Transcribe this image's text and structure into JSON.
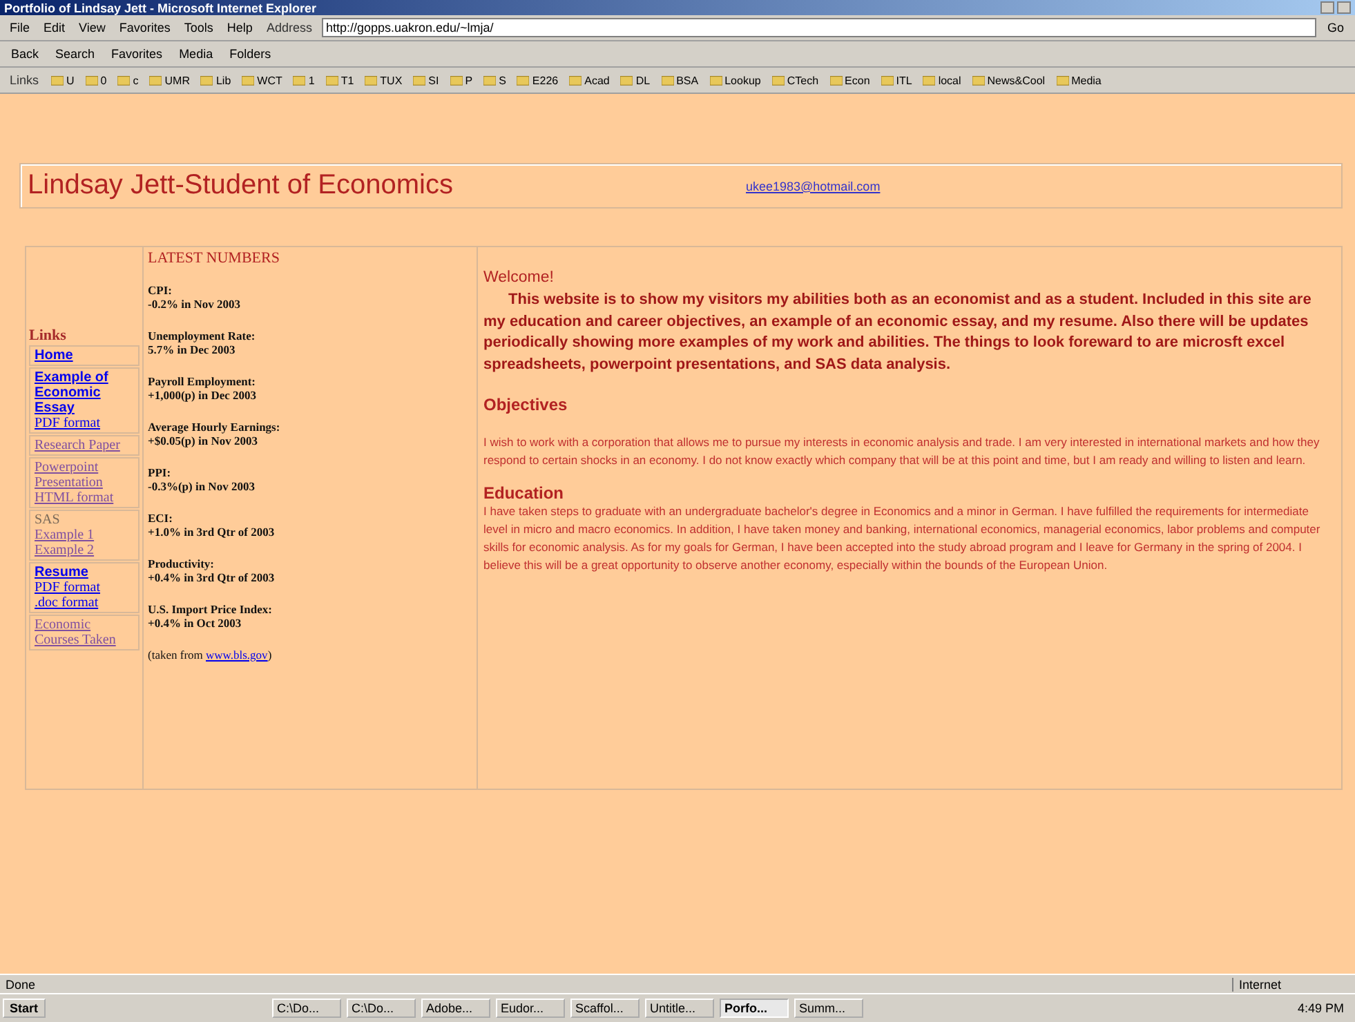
{
  "window": {
    "title": "Portfolio of Lindsay Jett - Microsoft Internet Explorer"
  },
  "menu": [
    "File",
    "Edit",
    "View",
    "Favorites",
    "Tools",
    "Help"
  ],
  "address": {
    "label": "Address",
    "value": "http://gopps.uakron.edu/~lmja/",
    "go": "Go"
  },
  "toolbar": [
    "Back",
    "Search",
    "Favorites",
    "Media",
    "Folders"
  ],
  "links_bar": {
    "label": "Links",
    "items": [
      "U",
      "0",
      "c",
      "UMR",
      "Lib",
      "WCT",
      "1",
      "T1",
      "TUX",
      "SI",
      "P",
      "S",
      "E226",
      "Acad",
      "DL",
      "BSA",
      "Lookup",
      "CTech",
      "Econ",
      "ITL",
      "local",
      "News&Cool",
      "Media"
    ]
  },
  "header": {
    "title": "Lindsay Jett-Student of Economics",
    "email": "ukee1983@hotmail.com"
  },
  "sidebar": {
    "heading": "Links",
    "groups": [
      {
        "items": [
          {
            "text": "Home",
            "bold": true,
            "visited": false
          }
        ]
      },
      {
        "items": [
          {
            "text": "Example of Economic Essay",
            "bold": true,
            "visited": false
          },
          {
            "text": "PDF format",
            "bold": false,
            "visited": false
          }
        ]
      },
      {
        "items": [
          {
            "text": "Research Paper",
            "bold": false,
            "visited": true
          }
        ]
      },
      {
        "items": [
          {
            "text": "Powerpoint Presentation",
            "bold": false,
            "visited": true
          },
          {
            "text": "HTML format",
            "bold": false,
            "visited": true
          }
        ]
      },
      {
        "label": "SAS",
        "items": [
          {
            "text": "Example 1",
            "bold": false,
            "visited": true
          },
          {
            "text": "Example 2",
            "bold": false,
            "visited": true
          }
        ]
      },
      {
        "items": [
          {
            "text": "Resume",
            "bold": true,
            "visited": false
          },
          {
            "text": "PDF format",
            "bold": false,
            "visited": false
          },
          {
            "text": ".doc format",
            "bold": false,
            "visited": false
          }
        ]
      },
      {
        "items": [
          {
            "text": "Economic Courses Taken",
            "bold": false,
            "visited": true
          }
        ]
      }
    ]
  },
  "numbers": {
    "heading": "LATEST NUMBERS",
    "entries": [
      {
        "name": "CPI:",
        "value": "-0.2% in Nov 2003"
      },
      {
        "name": "Unemployment Rate:",
        "value": "5.7% in Dec 2003"
      },
      {
        "name": "Payroll Employment:",
        "value": "+1,000(p) in Dec 2003"
      },
      {
        "name": "Average Hourly Earnings:",
        "value": "+$0.05(p) in Nov 2003"
      },
      {
        "name": "PPI:",
        "value": "-0.3%(p) in Nov 2003"
      },
      {
        "name": "ECI:",
        "value": "+1.0% in 3rd Qtr of 2003"
      },
      {
        "name": "Productivity:",
        "value": "+0.4% in 3rd Qtr of 2003"
      },
      {
        "name": "U.S. Import Price Index:",
        "value": "+0.4% in Oct 2003"
      }
    ],
    "source": "(taken from",
    "source_link": "www.bls.gov",
    "source_end": ")"
  },
  "content": {
    "welcome": "Welcome!",
    "intro": "This website is to show my visitors my abilities both as an economist and as a student.  Included in this site are my education and career objectives, an example of an economic essay, and my resume.  Also there will be updates periodically showing more examples of my work and abilities.  The things to look foreward to are microsft excel spreadsheets, powerpoint presentations, and SAS data analysis.",
    "sections": [
      {
        "heading": "Objectives",
        "text": "I wish to work with a corporation that allows me to pursue my interests in economic analysis and trade.   I am very interested in international markets and how they respond to certain shocks in an economy.   I do not know exactly which company that will be at this point and time, but I am ready and willing to listen and learn."
      },
      {
        "heading": "Education",
        "text": "I have taken steps to graduate with an undergraduate bachelor's degree in Economics and a minor in German.   I have fulfilled the requirements for intermediate level in micro and macro economics.  In addition, I have taken money and banking, international economics, managerial economics, labor problems and computer skills for economic analysis.   As for my goals for German, I have been accepted into the study abroad program and I leave for Germany in the spring of 2004.   I believe this will be a great opportunity to observe another economy, especially within the bounds of the European Union."
      }
    ]
  },
  "status_bar": {
    "text": "Done",
    "zone": "Internet"
  },
  "taskbar": {
    "start": "Start",
    "tasks": [
      {
        "label": "C:\\Do...",
        "selected": false
      },
      {
        "label": "C:\\Do...",
        "selected": false
      },
      {
        "label": "Adobe...",
        "selected": false
      },
      {
        "label": "Eudor...",
        "selected": false
      },
      {
        "label": "Scaffol...",
        "selected": false
      },
      {
        "label": "Untitle...",
        "selected": false
      },
      {
        "label": "Porfo...",
        "selected": true
      },
      {
        "label": "Summ...",
        "selected": false
      }
    ],
    "clock": "4:49 PM"
  }
}
